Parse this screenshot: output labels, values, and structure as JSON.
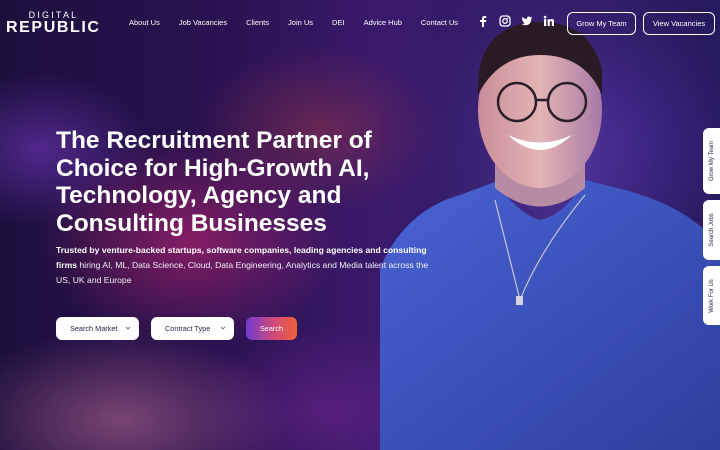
{
  "logo": {
    "top": "DIGITAL",
    "bottom": "REPUBLIC"
  },
  "nav": {
    "items": [
      "About Us",
      "Job Vacancies",
      "Clients",
      "Join Us",
      "DEI",
      "Advice Hub",
      "Contact Us"
    ]
  },
  "socials": [
    "facebook-icon",
    "instagram-icon",
    "twitter-icon",
    "linkedin-icon"
  ],
  "header_buttons": {
    "grow": "Grow My Team",
    "vacancies": "View Vacancies"
  },
  "hero": {
    "title": "The Recruitment Partner of Choice for High-Growth AI, Technology, Agency and Consulting Businesses",
    "subtitle_strong": "Trusted by venture-backed startups, software companies, leading agencies and consulting firms",
    "subtitle_rest": "hiring AI, ML, Data Science, Cloud, Data Engineering, Analytics and Media talent across the US, UK and Europe"
  },
  "search": {
    "market_label": "Search Market",
    "contract_label": "Contract Type",
    "button_label": "Search"
  },
  "side_tabs": {
    "grow": "Grow My Team",
    "jobs": "Search Jobs",
    "work": "Work For Us"
  },
  "colors": {
    "background_dark": "#1c0f3d",
    "accent_purple": "#6f3bd0",
    "accent_pink": "#d14a78",
    "accent_orange": "#f0603a",
    "sweater_blue": "#3d57c8"
  }
}
